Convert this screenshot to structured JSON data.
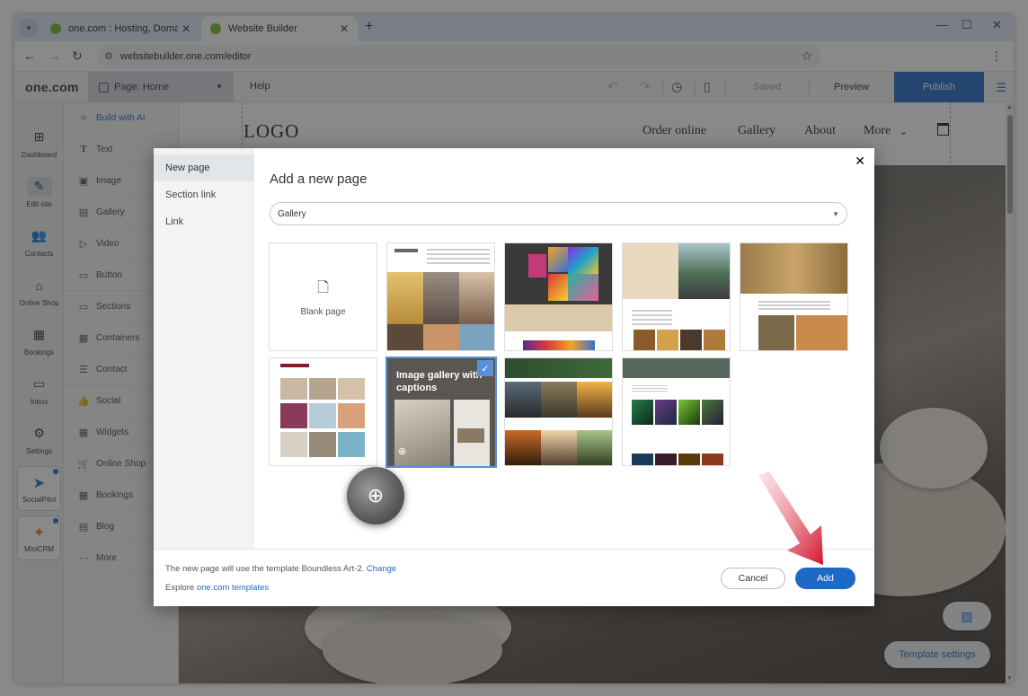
{
  "browser": {
    "tabs": [
      {
        "title": "one.com : Hosting, Domain, Em",
        "close": "✕"
      },
      {
        "title": "Website Builder",
        "close": "✕"
      }
    ],
    "new_tab": "+",
    "url": "websitebuilder.one.com/editor",
    "window_controls": [
      "—",
      "☐",
      "✕"
    ]
  },
  "toolbar": {
    "brand": "one.com",
    "page_label": "Page:",
    "page_name": "Home",
    "help": "Help",
    "saved": "Saved",
    "preview": "Preview",
    "publish": "Publish"
  },
  "rail": {
    "items": [
      {
        "label": "Dashboard",
        "icon": "dashboard-icon"
      },
      {
        "label": "Edit site",
        "icon": "edit-site-icon"
      },
      {
        "label": "Contacts",
        "icon": "contacts-icon"
      },
      {
        "label": "Online Shop",
        "icon": "shop-icon"
      },
      {
        "label": "Bookings",
        "icon": "bookings-icon"
      },
      {
        "label": "Inbox",
        "icon": "inbox-icon"
      },
      {
        "label": "Settings",
        "icon": "settings-icon"
      }
    ],
    "apps": [
      {
        "label": "SocialPilot",
        "icon": "socialpilot-icon"
      },
      {
        "label": "MiniCRM",
        "icon": "minicrm-icon"
      }
    ]
  },
  "elements": {
    "items": [
      {
        "label": "Build with AI",
        "icon": "sparkle-icon",
        "glyph": "✧"
      },
      {
        "label": "Text",
        "icon": "text-icon",
        "glyph": "T"
      },
      {
        "label": "Image",
        "icon": "image-icon",
        "glyph": "▣"
      },
      {
        "label": "Gallery",
        "icon": "gallery-icon",
        "glyph": "▤"
      },
      {
        "label": "Video",
        "icon": "video-icon",
        "glyph": "▷"
      },
      {
        "label": "Button",
        "icon": "button-icon",
        "glyph": "▭"
      },
      {
        "label": "Sections",
        "icon": "sections-icon",
        "glyph": "▭"
      },
      {
        "label": "Containers",
        "icon": "containers-icon",
        "glyph": "▦"
      },
      {
        "label": "Contact",
        "icon": "contact-icon",
        "glyph": "☰"
      },
      {
        "label": "Social",
        "icon": "social-icon",
        "glyph": "👍"
      },
      {
        "label": "Widgets",
        "icon": "widgets-icon",
        "glyph": "▦"
      },
      {
        "label": "Online Shop",
        "icon": "cart-icon",
        "glyph": "🛒"
      },
      {
        "label": "Bookings",
        "icon": "calendar-icon",
        "glyph": "▦"
      },
      {
        "label": "Blog",
        "icon": "blog-icon",
        "glyph": "▤"
      },
      {
        "label": "More",
        "icon": "more-icon",
        "glyph": "⋯"
      }
    ]
  },
  "canvas": {
    "logo": "LOGO",
    "nav": [
      "Order online",
      "Gallery",
      "About",
      "More"
    ],
    "template_settings": "Template settings"
  },
  "modal": {
    "side_nav": [
      "New page",
      "Section link",
      "Link"
    ],
    "title": "Add a new page",
    "category": "Gallery",
    "blank_label": "Blank page",
    "selected_caption": "Image gallery with captions",
    "footer_text": "The new page will use the template Boundless Art-2.",
    "footer_change": "Change",
    "footer_explore": "Explore",
    "footer_templates_link": "one.com templates",
    "cancel": "Cancel",
    "add": "Add"
  },
  "colors": {
    "accent": "#1e69c6",
    "selected_border": "#5b8fd9",
    "arrow": "#d3122c"
  }
}
